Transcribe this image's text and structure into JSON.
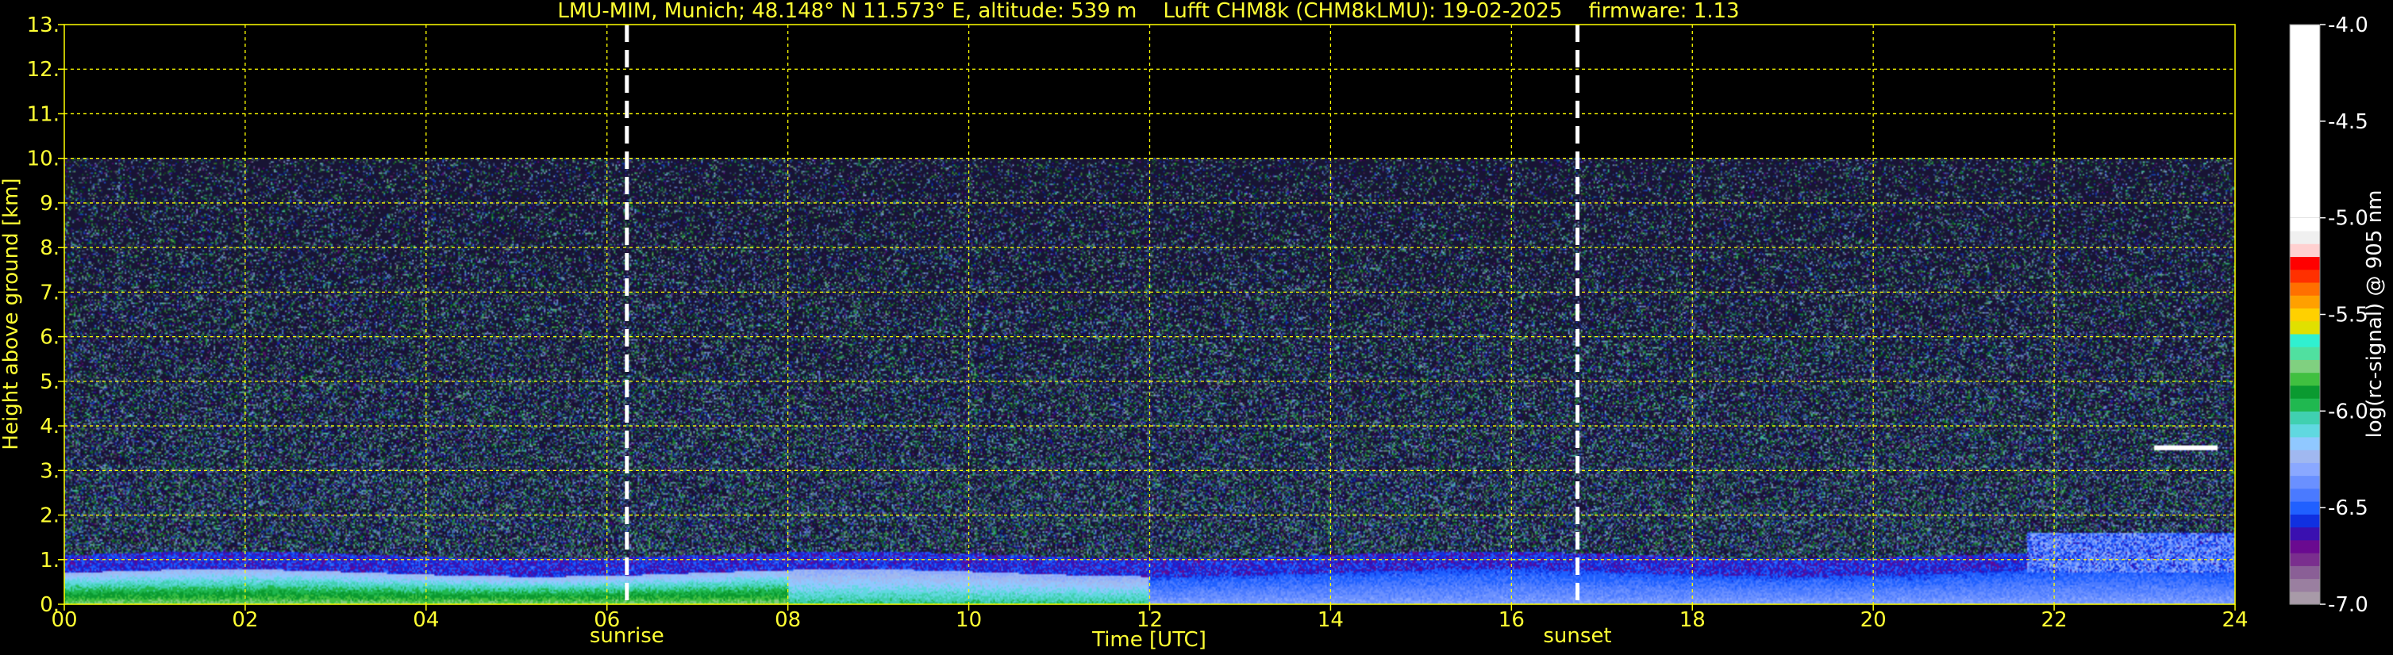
{
  "title": "LMU-MIM, Munich; 48.148° N 11.573° E, altitude: 539 m    Lufft CHM8k (CHM8kLMU): 19-02-2025    firmware: 1.13",
  "chart_data": {
    "type": "heatmap",
    "title": "LMU-MIM, Munich; 48.148° N 11.573° E, altitude: 539 m    Lufft CHM8k (CHM8kLMU): 19-02-2025    firmware: 1.13",
    "xlabel": "Time [UTC]",
    "ylabel": "Height above ground [km]",
    "xlim": [
      0,
      24
    ],
    "ylim": [
      0,
      13
    ],
    "x_ticks": [
      "00",
      "02",
      "04",
      "06",
      "08",
      "10",
      "12",
      "14",
      "16",
      "18",
      "20",
      "22",
      "24"
    ],
    "y_ticks": [
      "0.",
      "1.",
      "2.",
      "3.",
      "4.",
      "5.",
      "6.",
      "7.",
      "8.",
      "9.",
      "10.",
      "11.",
      "12.",
      "13."
    ],
    "grid": true,
    "grid_color": "#ffff00",
    "text_color": "#ffff33",
    "signal_top_km": 10,
    "events": [
      {
        "label": "sunrise",
        "time_utc": 6.22
      },
      {
        "label": "sunset",
        "time_utc": 16.73
      }
    ],
    "layers": [
      {
        "name": "boundary layer",
        "time_start": 0,
        "time_end": 24,
        "height_km": [
          0.0,
          0.7
        ]
      },
      {
        "name": "elevated aerosol layer",
        "time_start": 21.7,
        "time_end": 24,
        "height_km": [
          0.7,
          1.6
        ]
      },
      {
        "name": "cloud",
        "time_start": 23.1,
        "time_end": 23.8,
        "height_km": [
          3.45,
          3.55
        ]
      }
    ],
    "colorbar": {
      "label": "log(rc-signal) @ 905 nm",
      "range": [
        -7.0,
        -4.0
      ],
      "ticks": [
        "-4.0",
        "-4.5",
        "-5.0",
        "-5.5",
        "-6.0",
        "-6.5",
        "-7.0"
      ],
      "colors": [
        "#a89aa8",
        "#9a7fa0",
        "#8a5f96",
        "#7a2e8e",
        "#6a0a90",
        "#3a10b0",
        "#1030e0",
        "#2060ff",
        "#4a7aff",
        "#6a90ff",
        "#8aa8ff",
        "#a0b8f0",
        "#90c8ff",
        "#60d8e0",
        "#40d0b0",
        "#20b850",
        "#0a9a30",
        "#40c040",
        "#80d080",
        "#50e0a0",
        "#30f0d0",
        "#e0e000",
        "#ffd000",
        "#ffa000",
        "#ff7000",
        "#ff3000",
        "#ff0000",
        "#ffd0d0",
        "#f0f0f0",
        "#ffffff"
      ]
    }
  }
}
